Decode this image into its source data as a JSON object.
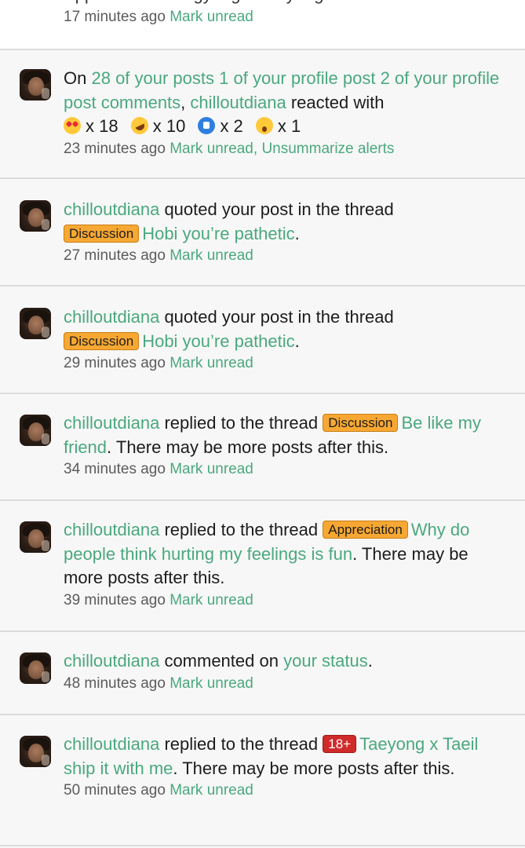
{
  "top": {
    "clipped_text": "Appreciation  Yangyang x Taeyong.",
    "time": "17 minutes ago",
    "action": "Mark unread"
  },
  "alerts": [
    {
      "prefix": "On",
      "summary_link": "28 of your posts 1 of your profile post 2 of your profile post comments",
      "comma": ",",
      "user": "chilloutdiana",
      "verb": "reacted with",
      "reactions": [
        {
          "icon": "heart-eyes-emoji-icon",
          "count": "x 18"
        },
        {
          "icon": "laughing-emoji-icon",
          "count": "x 10"
        },
        {
          "icon": "thumbs-up-icon",
          "count": "x 2"
        },
        {
          "icon": "wow-emoji-icon",
          "count": "x 1"
        }
      ],
      "time": "23 minutes ago",
      "action": "Mark unread",
      "action_sep": ",",
      "action2": "Unsummarize alerts"
    },
    {
      "user": "chilloutdiana",
      "text": "quoted your post in the thread",
      "label": "Discussion",
      "thread": "Hobi you’re pathetic",
      "end": ".",
      "time": "27 minutes ago",
      "action": "Mark unread"
    },
    {
      "user": "chilloutdiana",
      "text": "quoted your post in the thread",
      "label": "Discussion",
      "thread": "Hobi you’re pathetic",
      "end": ".",
      "time": "29 minutes ago",
      "action": "Mark unread"
    },
    {
      "user": "chilloutdiana",
      "text": "replied to the thread",
      "label": "Discussion",
      "thread": "Be like my friend",
      "end": ". There may be more posts after this.",
      "time": "34 minutes ago",
      "action": "Mark unread"
    },
    {
      "user": "chilloutdiana",
      "text": "replied to the thread",
      "label": "Appreciation",
      "thread": "Why do people think hurting my feelings is fun",
      "end": ". There may be more posts after this.",
      "time": "39 minutes ago",
      "action": "Mark unread"
    },
    {
      "user": "chilloutdiana",
      "text": "commented on",
      "thread": "your status",
      "end": ".",
      "time": "48 minutes ago",
      "action": "Mark unread"
    },
    {
      "user": "chilloutdiana",
      "text": "replied to the thread",
      "label": "18+",
      "thread": "Taeyong x Taeil ship it with me",
      "end": ". There may be more posts after this.",
      "time": "50 minutes ago",
      "action": "Mark unread"
    }
  ],
  "colors": {
    "link": "#4aa87f",
    "label_discussion": "#f7a833",
    "label_appreciation": "#f7a833",
    "label_18": "#cf2b2b"
  }
}
